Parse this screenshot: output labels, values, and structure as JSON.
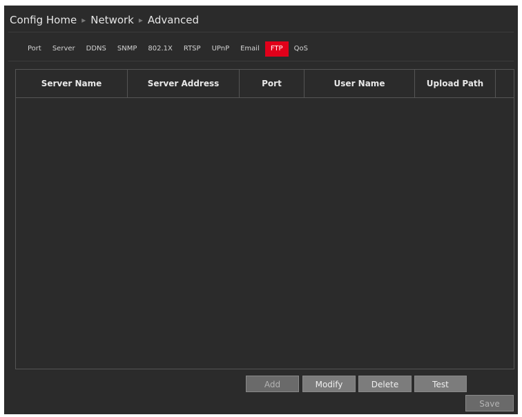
{
  "breadcrumb": {
    "items": [
      "Config Home",
      "Network",
      "Advanced"
    ]
  },
  "tabs": [
    {
      "label": "Port",
      "active": false
    },
    {
      "label": "Server",
      "active": false
    },
    {
      "label": "DDNS",
      "active": false
    },
    {
      "label": "SNMP",
      "active": false
    },
    {
      "label": "802.1X",
      "active": false
    },
    {
      "label": "RTSP",
      "active": false
    },
    {
      "label": "UPnP",
      "active": false
    },
    {
      "label": "Email",
      "active": false
    },
    {
      "label": "FTP",
      "active": true
    },
    {
      "label": "QoS",
      "active": false
    }
  ],
  "table": {
    "columns": [
      "Server Name",
      "Server Address",
      "Port",
      "User Name",
      "Upload Path",
      ""
    ],
    "rows": []
  },
  "buttons": {
    "add": "Add",
    "modify": "Modify",
    "delete": "Delete",
    "test": "Test",
    "save": "Save"
  },
  "colors": {
    "background": "#2b2b2b",
    "accent": "#e1001a",
    "border": "#555555",
    "button": "#7c7c7c"
  }
}
